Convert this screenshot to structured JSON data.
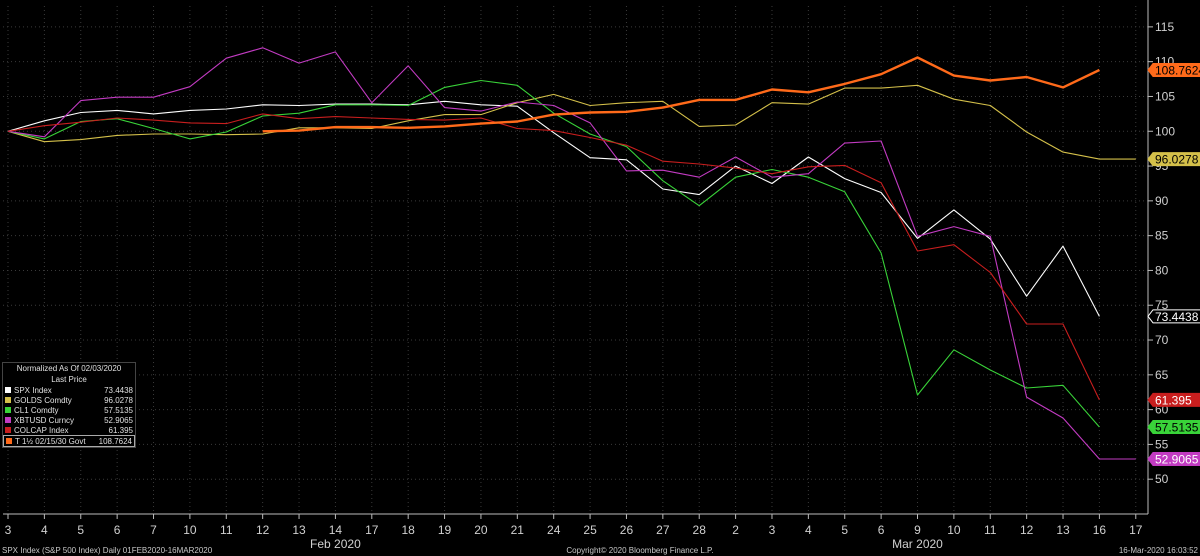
{
  "chart_data": {
    "type": "line",
    "title": "",
    "ylim": [
      45,
      118
    ],
    "y_ticks": [
      50,
      55,
      60,
      65,
      70,
      75,
      80,
      85,
      90,
      95,
      100,
      105,
      110,
      115
    ],
    "x": [
      "3",
      "4",
      "5",
      "6",
      "7",
      "10",
      "11",
      "12",
      "13",
      "14",
      "17",
      "18",
      "19",
      "20",
      "21",
      "24",
      "25",
      "26",
      "27",
      "28",
      "2",
      "3",
      "4",
      "5",
      "6",
      "9",
      "10",
      "11",
      "12",
      "13",
      "16",
      "17"
    ],
    "month_labels": [
      {
        "label": "Feb 2020",
        "at_index": 9
      },
      {
        "label": "Mar 2020",
        "at_index": 25
      }
    ],
    "grid": true,
    "legend_position": "bottom-left",
    "series": [
      {
        "name": "SPX Index",
        "color": "#ffffff",
        "last": "73.4438",
        "values": [
          100,
          101.5,
          102.7,
          103.0,
          102.5,
          103.0,
          103.2,
          103.8,
          103.7,
          103.9,
          103.9,
          103.8,
          104.3,
          103.8,
          103.6,
          99.8,
          96.2,
          95.9,
          91.7,
          90.9,
          95.0,
          92.5,
          96.3,
          93.2,
          91.2,
          84.6,
          88.7,
          84.5,
          76.3,
          83.5,
          73.4,
          null
        ]
      },
      {
        "name": "GOLDS Comdty",
        "color": "#d4c04a",
        "last": "96.0278",
        "values": [
          100,
          98.5,
          98.8,
          99.4,
          99.6,
          99.6,
          99.5,
          99.6,
          100.5,
          100.5,
          100.4,
          101.5,
          102.4,
          102.4,
          104.1,
          105.3,
          103.7,
          104.1,
          104.3,
          100.7,
          100.9,
          104.1,
          103.9,
          106.2,
          106.2,
          106.6,
          104.6,
          103.7,
          99.9,
          97.0,
          96.0,
          96.0
        ]
      },
      {
        "name": "CL1 Comdty",
        "color": "#39d339",
        "last": "57.5135",
        "values": [
          100,
          98.9,
          101.4,
          101.8,
          100.4,
          98.9,
          99.9,
          102.2,
          102.6,
          103.8,
          103.8,
          103.7,
          106.3,
          107.3,
          106.6,
          102.6,
          99.6,
          97.8,
          92.9,
          89.3,
          93.4,
          94.5,
          93.4,
          91.3,
          82.5,
          62.1,
          68.6,
          65.7,
          63.1,
          63.5,
          57.5,
          null
        ]
      },
      {
        "name": "XBTUSD Curncy",
        "color": "#c23bc2",
        "last": "52.9065",
        "values": [
          100,
          99.2,
          104.4,
          104.9,
          104.9,
          106.4,
          110.5,
          112.0,
          109.8,
          111.4,
          104.1,
          109.4,
          103.4,
          102.9,
          104.2,
          103.7,
          101.2,
          94.3,
          94.4,
          93.4,
          96.3,
          93.4,
          93.9,
          98.3,
          98.6,
          84.9,
          86.3,
          84.9,
          61.8,
          58.8,
          52.9,
          52.9
        ]
      },
      {
        "name": "COLCAP Index",
        "color": "#c81e1e",
        "last": "61.395",
        "values": [
          100,
          100.8,
          101.3,
          101.9,
          101.6,
          101.2,
          101.1,
          102.5,
          101.8,
          102.1,
          101.9,
          101.7,
          101.6,
          101.9,
          100.4,
          100.1,
          99.1,
          98.0,
          95.7,
          95.3,
          94.7,
          93.9,
          94.9,
          95.1,
          92.6,
          82.8,
          83.7,
          79.7,
          72.3,
          72.3,
          61.4,
          null
        ]
      },
      {
        "name": "T 1½  02/15/30 Govt",
        "color": "#ff6a1a",
        "last": "108.7624",
        "values": [
          null,
          null,
          null,
          null,
          null,
          null,
          null,
          100.0,
          100.1,
          100.6,
          100.6,
          100.5,
          100.7,
          101.1,
          101.4,
          102.4,
          102.7,
          102.8,
          103.4,
          104.5,
          104.5,
          106.0,
          105.6,
          106.8,
          108.2,
          110.6,
          108.0,
          107.3,
          107.8,
          106.3,
          108.8,
          null
        ]
      }
    ]
  },
  "legend": {
    "header_line1": "Normalized As Of 02/03/2020",
    "header_line2": "Last Price"
  },
  "footer": {
    "left": "SPX Index (S&P 500 Index)  Daily 01FEB2020-16MAR2020",
    "center": "Copyright© 2020 Bloomberg Finance L.P.",
    "right": "16-Mar-2020 16:03:52"
  }
}
